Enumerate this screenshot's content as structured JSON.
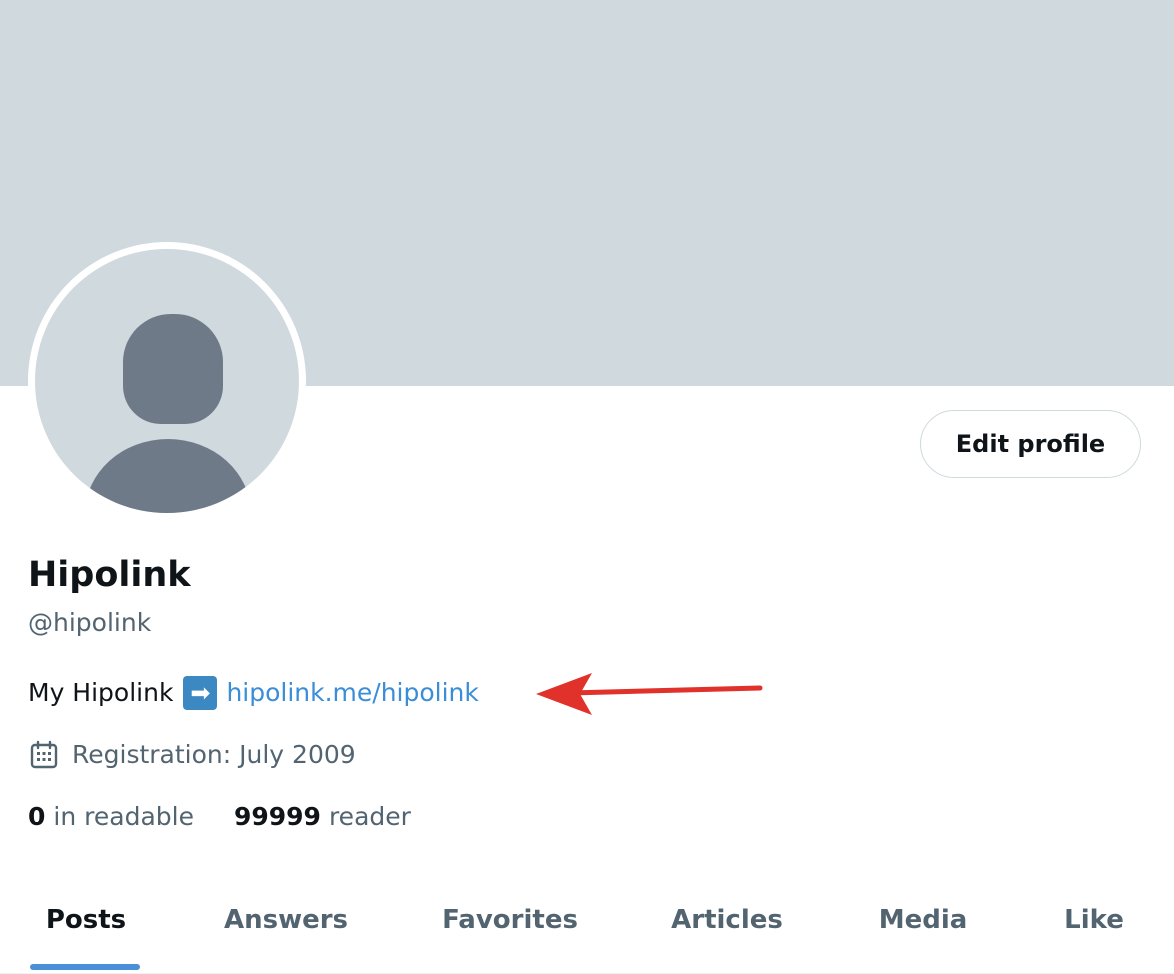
{
  "profile": {
    "name": "Hipolink",
    "handle": "@hipolink",
    "edit_label": "Edit profile",
    "bio": {
      "prefix": "My Hipolink",
      "arrow_emoji": "➡",
      "link": "hipolink.me/hipolink"
    },
    "registration": "Registration: July 2009",
    "stats": [
      {
        "value": "0",
        "label": "in readable"
      },
      {
        "value": "99999",
        "label": "reader"
      }
    ]
  },
  "tabs": [
    {
      "label": "Posts",
      "active": true
    },
    {
      "label": "Answers",
      "active": false
    },
    {
      "label": "Favorites",
      "active": false
    },
    {
      "label": "Articles",
      "active": false
    },
    {
      "label": "Media",
      "active": false
    },
    {
      "label": "Like",
      "active": false
    }
  ],
  "icons": {
    "avatar": "default-avatar-icon",
    "calendar": "calendar-icon",
    "annotation": "red-arrow-icon"
  },
  "colors": {
    "banner": "#cfd9de",
    "link": "#3a8ed8",
    "accent": "#4a90d9",
    "annotation": "#e0322b"
  }
}
